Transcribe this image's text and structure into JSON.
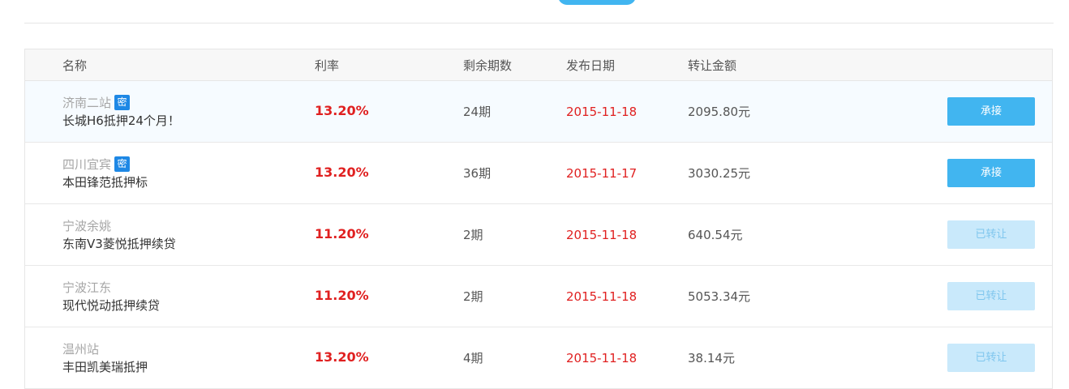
{
  "header_partial": {
    "label": "",
    "pill": ""
  },
  "table": {
    "headers": [
      "名称",
      "利率",
      "剩余期数",
      "发布日期",
      "转让金额"
    ],
    "secret_badge": "密",
    "rows": [
      {
        "location": "济南二站",
        "secret": true,
        "name": "长城H6抵押24个月！",
        "rate": "13.20%",
        "periods": "24期",
        "date": "2015-11-18",
        "amount": "2095.80元",
        "action": "承接",
        "action_state": "active"
      },
      {
        "location": "四川宜宾",
        "secret": true,
        "name": "本田锋范抵押标",
        "rate": "13.20%",
        "periods": "36期",
        "date": "2015-11-17",
        "amount": "3030.25元",
        "action": "承接",
        "action_state": "active"
      },
      {
        "location": "宁波余姚",
        "secret": false,
        "name": "东南V3菱悦抵押续贷",
        "rate": "11.20%",
        "periods": "2期",
        "date": "2015-11-18",
        "amount": "640.54元",
        "action": "已转让",
        "action_state": "done"
      },
      {
        "location": "宁波江东",
        "secret": false,
        "name": "现代悦动抵押续贷",
        "rate": "11.20%",
        "periods": "2期",
        "date": "2015-11-18",
        "amount": "5053.34元",
        "action": "已转让",
        "action_state": "done"
      },
      {
        "location": "温州站",
        "secret": false,
        "name": "丰田凯美瑞抵押",
        "rate": "13.20%",
        "periods": "4期",
        "date": "2015-11-18",
        "amount": "38.14元",
        "action": "已转让",
        "action_state": "done"
      }
    ]
  },
  "colors": {
    "accent": "#41b5f0",
    "accent_disabled": "#c9e9fb",
    "rate_red": "#e02020",
    "badge_blue": "#1e88e5",
    "highlight_row": "#f6fbff"
  }
}
